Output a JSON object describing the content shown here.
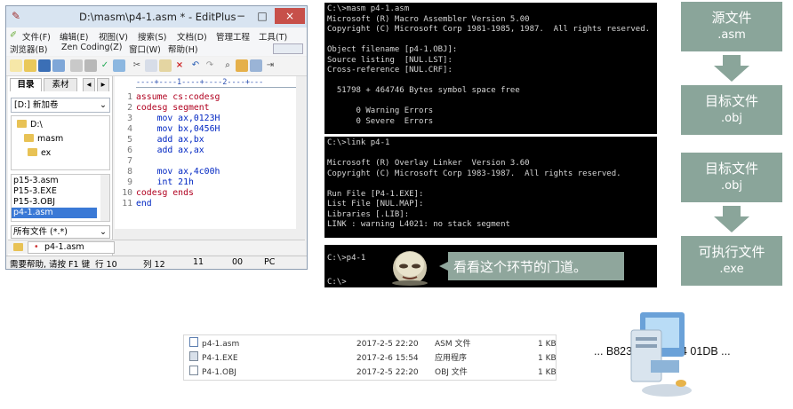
{
  "editplus": {
    "title": "D:\\masm\\p4-1.asm * - EditPlus",
    "min_glyph": "−",
    "max_glyph": "□",
    "close_glyph": "×",
    "menu": [
      "文件(F)",
      "编辑(E)",
      "视图(V)",
      "搜索(S)",
      "文档(D)",
      "管理工程",
      "工具(T)",
      "浏览器(B)",
      "Zen Coding(Z)",
      "窗口(W)",
      "帮助(H)"
    ],
    "tabs": [
      "目录",
      "素材"
    ],
    "drive": "[D:] 新加卷",
    "tree": [
      "D:\\",
      "masm",
      "ex"
    ],
    "files": [
      "p15-3.asm",
      "P15-3.EXE",
      "P15-3.OBJ",
      "p4-1.asm"
    ],
    "filter": "所有文件 (*.*)",
    "ruler": "----+----1----+----2----+---",
    "code": [
      {
        "n": "1",
        "text": "assume cs:codesg"
      },
      {
        "n": "2",
        "text": "codesg segment"
      },
      {
        "n": "3",
        "text": "mov ax,0123H"
      },
      {
        "n": "4",
        "text": "mov bx,0456H"
      },
      {
        "n": "5",
        "text": "add ax,bx"
      },
      {
        "n": "6",
        "text": "add ax,ax"
      },
      {
        "n": "7",
        "text": ""
      },
      {
        "n": "8",
        "text": "mov ax,4c00h"
      },
      {
        "n": "9",
        "text": "int 21h"
      },
      {
        "n": "10",
        "text": "codesg ends"
      },
      {
        "n": "11",
        "text": "end"
      }
    ],
    "doc_tab": "p4-1.asm",
    "status": {
      "help": "需要帮助, 请按 F1 键",
      "row": "行 10",
      "col": "列 12",
      "v1": "11",
      "v2": "00",
      "mode": "PC"
    }
  },
  "console1": [
    "C:\\>masm p4-1.asm",
    "Microsoft (R) Macro Assembler Version 5.00",
    "Copyright (C) Microsoft Corp 1981-1985, 1987.  All rights reserved.",
    "",
    "Object filename [p4-1.OBJ]:",
    "Source listing  [NUL.LST]:",
    "Cross-reference [NUL.CRF]:",
    "",
    "  51798 + 464746 Bytes symbol space free",
    "",
    "      0 Warning Errors",
    "      0 Severe  Errors"
  ],
  "console2": [
    "C:\\>link p4-1",
    "",
    "Microsoft (R) Overlay Linker  Version 3.60",
    "Copyright (C) Microsoft Corp 1983-1987.  All rights reserved.",
    "",
    "Run File [P4-1.EXE]:",
    "List File [NUL.MAP]:",
    "Libraries [.LIB]:",
    "LINK : warning L4021: no stack segment"
  ],
  "console3": [
    "C:\\>p4-1",
    "",
    "",
    "C:\\>"
  ],
  "callout": "看看这个环节的门道。",
  "flow": [
    {
      "l1": "源文件",
      "l2": ".asm"
    },
    {
      "l1": "目标文件",
      "l2": ".obj"
    },
    {
      "l1": "目标文件",
      "l2": ".obj"
    },
    {
      "l1": "可执行文件",
      "l2": ".exe"
    }
  ],
  "explorer": [
    {
      "name": "p4-1.asm",
      "date": "2017-2-5 22:20",
      "type": "ASM 文件",
      "size": "1 KB"
    },
    {
      "name": "P4-1.EXE",
      "date": "2017-2-6 15:54",
      "type": "应用程序",
      "size": "1 KB"
    },
    {
      "name": "P4-1.OBJ",
      "date": "2017-2-5 22:20",
      "type": "OBJ 文件",
      "size": "1 KB"
    }
  ],
  "hex": "... B82301 BB5604 01DB ..."
}
